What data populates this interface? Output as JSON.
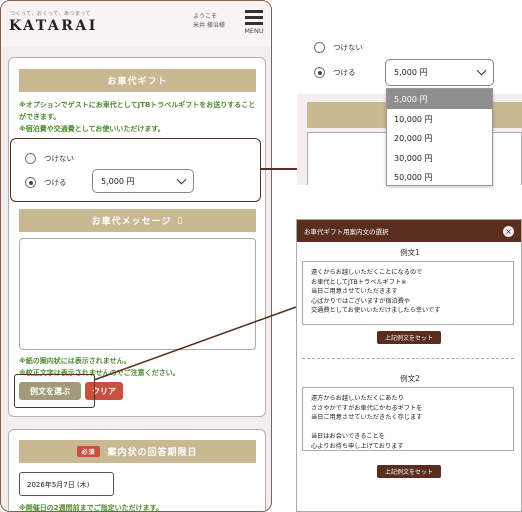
{
  "header": {
    "tagline": "つくって、おくって、あつまって",
    "logo": "KATARAI",
    "welcome_line1": "ようこそ",
    "welcome_line2": "米井 様治様",
    "menu_label": "MENU"
  },
  "gift": {
    "title": "お車代ギフト",
    "note1": "※オプションでゲストにお車代としてJTBトラベルギフトをお送りすることができます。",
    "note2": "※宿泊費や交通費としてお使いいただけます。",
    "option_none": "つけない",
    "option_add": "つける",
    "selected_amount": "5,000 円"
  },
  "message": {
    "title": "お車代メッセージ",
    "title_icon": "▯",
    "note1": "※紙の案内状には表示されません。",
    "note2": "※校正文字は表示されませんのでご注意ください。",
    "choose_button": "例文を選ぶ",
    "clear_button": "クリア"
  },
  "deadline": {
    "required_badge": "必須",
    "title": "案内状の回答期限日",
    "date_value": "2026年5月7日 (木)",
    "note": "※開催日の2週間前までご指定いただけます。"
  },
  "dropdown": {
    "option_none": "つけない",
    "option_add": "つける",
    "selected_amount": "5,000 円",
    "options": [
      "5,000 円",
      "10,000 円",
      "20,000 円",
      "30,000 円",
      "50,000 円"
    ],
    "selected_index": 0
  },
  "modal": {
    "title": "お車代ギフト用案内文の選択",
    "close_icon": "×",
    "examples": [
      {
        "label": "例文1",
        "lines": [
          "遠くからお越しいただくことになるので",
          "お車代としてJTBトラベルギフト※",
          "当日ご用意させていただきます",
          "心ばかりではございますが宿泊費や",
          "交通費としてお使いいただけましたら幸いです"
        ],
        "button": "上記例文をセット"
      },
      {
        "label": "例文2",
        "lines": [
          "遠方からお越しいただくにあたり",
          "ささやかですがお車代にかわるギフトを",
          "当日ご用意させていただきたく存じます",
          "",
          "当日はお会いできることを",
          "心よりお待ち申し上げております"
        ],
        "button": "上記例文をセット"
      }
    ]
  },
  "colors": {
    "accent_brown": "#5a2e1f",
    "section_tan": "#c9b892",
    "note_green": "#4d8a2d",
    "danger_red": "#c8503f",
    "button_khaki": "#a39a7c"
  }
}
